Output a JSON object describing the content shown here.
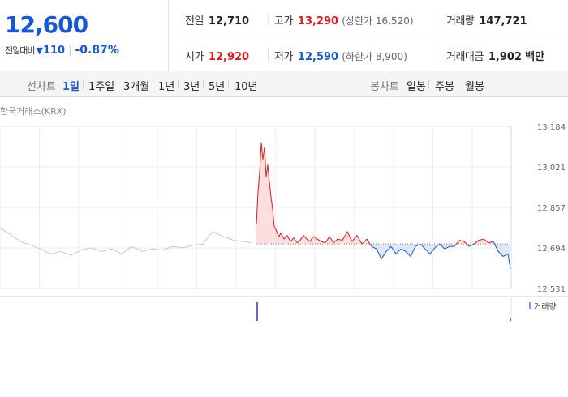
{
  "quote": {
    "price": "12,600",
    "change_label": "전일대비",
    "change_icon": "down-triangle-icon",
    "change_amount": "110",
    "change_rate": "-0.87%",
    "prev_close_label": "전일",
    "prev_close": "12,710",
    "high_label": "고가",
    "high": "13,290",
    "upper_limit": "(상한가 16,520)",
    "volume_label": "거래량",
    "volume": "147,721",
    "open_label": "시가",
    "open": "12,920",
    "low_label": "저가",
    "low": "12,590",
    "lower_limit": "(하한가 8,900)",
    "trade_value_label": "거래대금",
    "trade_value": "1,902",
    "trade_value_unit": "백만"
  },
  "tabs": {
    "line_label": "선차트",
    "line_periods": [
      "1일",
      "1주일",
      "3개월",
      "1년",
      "3년",
      "5년",
      "10년"
    ],
    "selected": "1일",
    "candle_label": "봉차트",
    "candle_periods": [
      "일봉",
      "주봉",
      "월봉"
    ]
  },
  "colors": {
    "up": "#e0191e",
    "down": "#1657d6",
    "up_fill": "#fbd8d8",
    "down_fill": "#d8e2f7",
    "premarket": "#c8c8c8"
  },
  "chart_data": {
    "type": "line",
    "source_label": "한국거래소(KRX)",
    "y_ticks": [
      "13,184",
      "13,021",
      "12,857",
      "12,694",
      "12,531"
    ],
    "ylim": [
      12531,
      13184
    ],
    "baseline": 12710,
    "grid": true,
    "volume_legend": "거래량",
    "premarket_x": [
      0,
      12,
      25,
      38,
      50,
      62,
      75,
      88,
      100,
      112,
      125,
      138,
      150,
      162,
      175,
      188,
      200,
      212,
      225,
      238,
      250,
      262,
      275,
      288,
      300,
      310
    ],
    "premarket_y": [
      12775,
      12750,
      12720,
      12705,
      12690,
      12670,
      12680,
      12665,
      12685,
      12695,
      12680,
      12690,
      12670,
      12700,
      12680,
      12690,
      12685,
      12700,
      12695,
      12705,
      12710,
      12760,
      12740,
      12725,
      12720,
      12715
    ],
    "session_x": [
      0,
      2,
      4,
      6,
      8,
      10,
      12,
      14,
      16,
      18,
      20,
      22,
      24,
      26,
      28,
      30,
      34,
      38,
      42,
      46,
      50,
      54,
      58,
      62,
      66,
      70,
      75,
      80,
      85,
      90,
      95,
      100,
      106,
      112,
      118,
      124,
      130,
      136,
      142,
      148,
      154,
      160,
      166,
      172,
      178,
      184,
      190,
      196,
      202,
      208,
      214,
      220,
      226,
      232,
      238,
      244,
      250,
      256,
      262,
      268,
      274,
      280,
      286,
      292,
      298,
      304,
      310,
      313
    ],
    "session_y": [
      12790,
      12920,
      13000,
      13120,
      13050,
      13100,
      12980,
      13030,
      12960,
      12900,
      12850,
      12780,
      12770,
      12750,
      12740,
      12755,
      12730,
      12745,
      12720,
      12735,
      12715,
      12725,
      12745,
      12730,
      12720,
      12740,
      12730,
      12720,
      12715,
      12740,
      12715,
      12730,
      12725,
      12760,
      12720,
      12745,
      12710,
      12730,
      12700,
      12690,
      12650,
      12680,
      12700,
      12670,
      12690,
      12680,
      12660,
      12700,
      12710,
      12690,
      12670,
      12695,
      12710,
      12690,
      12700,
      12700,
      12725,
      12720,
      12700,
      12710,
      12725,
      12730,
      12715,
      12720,
      12680,
      12660,
      12670,
      12610
    ],
    "volume_spike_x": 316
  }
}
